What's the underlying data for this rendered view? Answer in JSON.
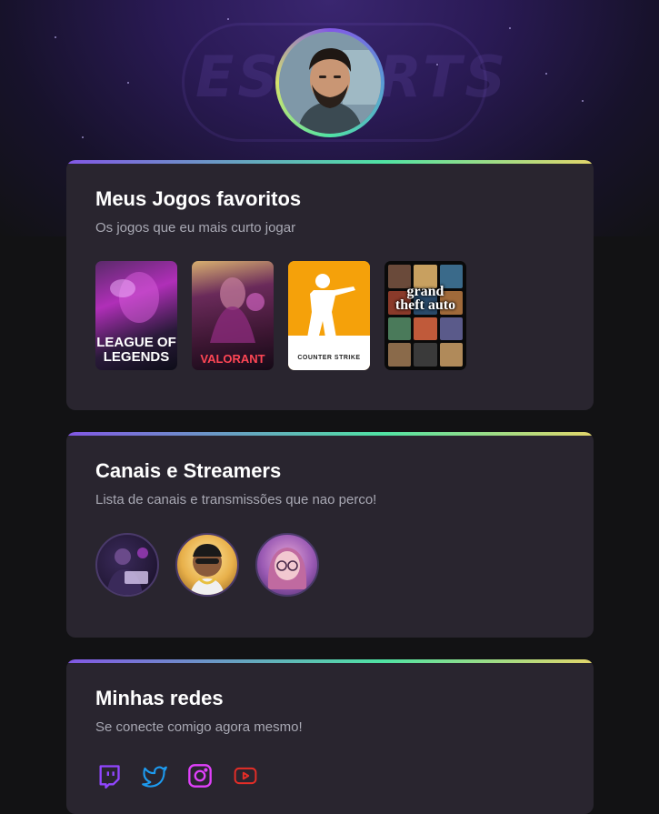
{
  "background": {
    "logo_text": "ESPORTS"
  },
  "profile": {
    "avatar_alt": "Profile photo"
  },
  "favorite_games": {
    "title": "Meus Jogos favoritos",
    "subtitle": "Os jogos que eu mais curto jogar",
    "games": [
      {
        "name": "League of Legends",
        "label": "LEAGUE OF LEGENDS"
      },
      {
        "name": "Valorant",
        "label": "VALORANT"
      },
      {
        "name": "Counter-Strike",
        "label": "COUNTER STRIKE"
      },
      {
        "name": "Grand Theft Auto V",
        "label": "grand theft auto"
      }
    ]
  },
  "channels": {
    "title": "Canais e Streamers",
    "subtitle": "Lista de canais e transmissões que nao perco!",
    "streamers": [
      {
        "name": "streamer-1"
      },
      {
        "name": "streamer-2"
      },
      {
        "name": "streamer-3"
      }
    ]
  },
  "networks": {
    "title": "Minhas redes",
    "subtitle": "Se conecte comigo agora mesmo!",
    "items": [
      {
        "icon": "twitch-icon",
        "color": "#9146ff"
      },
      {
        "icon": "twitter-icon",
        "color": "#1d9bf0"
      },
      {
        "icon": "instagram-icon",
        "color": "#e040fb"
      },
      {
        "icon": "youtube-icon",
        "color": "#e52d27"
      }
    ]
  }
}
